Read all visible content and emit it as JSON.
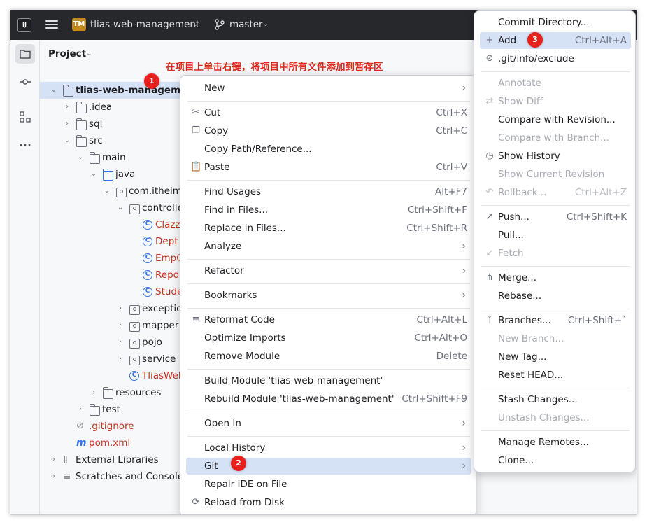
{
  "titlebar": {
    "app_logo": "IJ",
    "project_badge": "TM",
    "project_name": "tlias-web-management",
    "branch": "master"
  },
  "panel": {
    "title": "Project",
    "annotation": "在项目上单击右键，将项目中所有文件添加到暂存区"
  },
  "tree": [
    {
      "label": "tlias-web-management",
      "shown": "tlias-web-manageme",
      "icon": "folder-icon"
    },
    {
      "label": ".idea",
      "icon": "folder-icon"
    },
    {
      "label": "sql",
      "icon": "folder-icon"
    },
    {
      "label": "src",
      "icon": "folder-icon"
    },
    {
      "label": "main",
      "icon": "folder-icon"
    },
    {
      "label": "java",
      "icon": "folder-blue-icon"
    },
    {
      "label": "com.itheima",
      "icon": "package-icon"
    },
    {
      "label": "controlle",
      "icon": "package-icon"
    },
    {
      "label": "Clazz",
      "icon": "class-icon"
    },
    {
      "label": "Dept",
      "icon": "class-icon"
    },
    {
      "label": "EmpC",
      "icon": "class-icon"
    },
    {
      "label": "Repor",
      "icon": "class-icon"
    },
    {
      "label": "Stude",
      "icon": "class-icon"
    },
    {
      "label": "exceptio",
      "icon": "package-icon"
    },
    {
      "label": "mapper",
      "icon": "package-icon"
    },
    {
      "label": "pojo",
      "icon": "package-icon"
    },
    {
      "label": "service",
      "icon": "package-icon"
    },
    {
      "label": "TliasWeb",
      "icon": "spring-class-icon"
    },
    {
      "label": "resources",
      "icon": "resources-folder-icon"
    },
    {
      "label": "test",
      "icon": "folder-icon"
    },
    {
      "label": ".gitignore",
      "icon": "ignore-file-icon"
    },
    {
      "label": "pom.xml",
      "icon": "maven-icon"
    },
    {
      "label": "External Libraries",
      "icon": "library-icon"
    },
    {
      "label": "Scratches and Consoles",
      "icon": "scratches-icon"
    }
  ],
  "badges": {
    "one": "1",
    "two": "2",
    "three": "3"
  },
  "context_menu": {
    "new": "New",
    "cut": "Cut",
    "cut_sc": "Ctrl+X",
    "copy": "Copy",
    "copy_sc": "Ctrl+C",
    "copy_path": "Copy Path/Reference...",
    "paste": "Paste",
    "paste_sc": "Ctrl+V",
    "find_usages": "Find Usages",
    "find_usages_sc": "Alt+F7",
    "find_in_files": "Find in Files...",
    "find_in_files_sc": "Ctrl+Shift+F",
    "replace_in_files": "Replace in Files...",
    "replace_in_files_sc": "Ctrl+Shift+R",
    "analyze": "Analyze",
    "refactor": "Refactor",
    "bookmarks": "Bookmarks",
    "reformat": "Reformat Code",
    "reformat_sc": "Ctrl+Alt+L",
    "optimize": "Optimize Imports",
    "optimize_sc": "Ctrl+Alt+O",
    "remove_module": "Remove Module",
    "remove_module_sc": "Delete",
    "build_module": "Build Module 'tlias-web-management'",
    "rebuild_module": "Rebuild Module 'tlias-web-management'",
    "rebuild_module_sc": "Ctrl+Shift+F9",
    "open_in": "Open In",
    "local_history": "Local History",
    "git": "Git",
    "repair_ide": "Repair IDE on File",
    "reload_disk": "Reload from Disk"
  },
  "git_menu": {
    "commit_dir": "Commit Directory...",
    "add": "Add",
    "add_sc": "Ctrl+Alt+A",
    "exclude": ".git/info/exclude",
    "annotate": "Annotate",
    "show_diff": "Show Diff",
    "compare_revision": "Compare with Revision...",
    "compare_branch": "Compare with Branch...",
    "show_history": "Show History",
    "show_current_revision": "Show Current Revision",
    "rollback": "Rollback...",
    "rollback_sc": "Ctrl+Alt+Z",
    "push": "Push...",
    "push_sc": "Ctrl+Shift+K",
    "pull": "Pull...",
    "fetch": "Fetch",
    "merge": "Merge...",
    "rebase": "Rebase...",
    "branches": "Branches...",
    "branches_sc": "Ctrl+Shift+`",
    "new_branch": "New Branch...",
    "new_tag": "New Tag...",
    "reset_head": "Reset HEAD...",
    "stash": "Stash Changes...",
    "unstash": "Unstash Changes...",
    "manage_remotes": "Manage Remotes...",
    "clone": "Clone..."
  }
}
